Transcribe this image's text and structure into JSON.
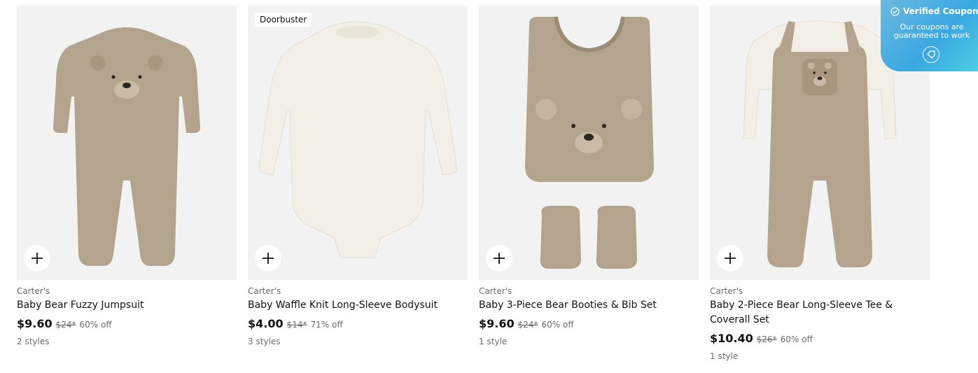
{
  "products": [
    {
      "brand": "Carter's",
      "name": "Baby Bear Fuzzy Jumpsuit",
      "price": "$9.60",
      "original_price": "$24*",
      "discount": "60% off",
      "styles": "2 styles",
      "badge": ""
    },
    {
      "brand": "Carter's",
      "name": "Baby Waffle Knit Long-Sleeve Bodysuit",
      "price": "$4.00",
      "original_price": "$14*",
      "discount": "71% off",
      "styles": "3 styles",
      "badge": "Doorbuster"
    },
    {
      "brand": "Carter's",
      "name": "Baby 3-Piece Bear Booties & Bib Set",
      "price": "$9.60",
      "original_price": "$24*",
      "discount": "60% off",
      "styles": "1 style",
      "badge": ""
    },
    {
      "brand": "Carter's",
      "name": "Baby 2-Piece Bear Long-Sleeve Tee & Coverall Set",
      "price": "$10.40",
      "original_price": "$26*",
      "discount": "60% off",
      "styles": "1 style",
      "badge": ""
    }
  ],
  "coupon": {
    "title": "Verified Coupon",
    "subtitle": "Our coupons are guaranteed to work"
  },
  "icons": {
    "add": "plus-icon",
    "verified": "check-circle-icon",
    "coupon": "tag-icon"
  },
  "colors": {
    "image_bg": "#f2f2f2",
    "bear_brown": "#b4a48d",
    "coupon_blue": "#3aa8e0"
  }
}
